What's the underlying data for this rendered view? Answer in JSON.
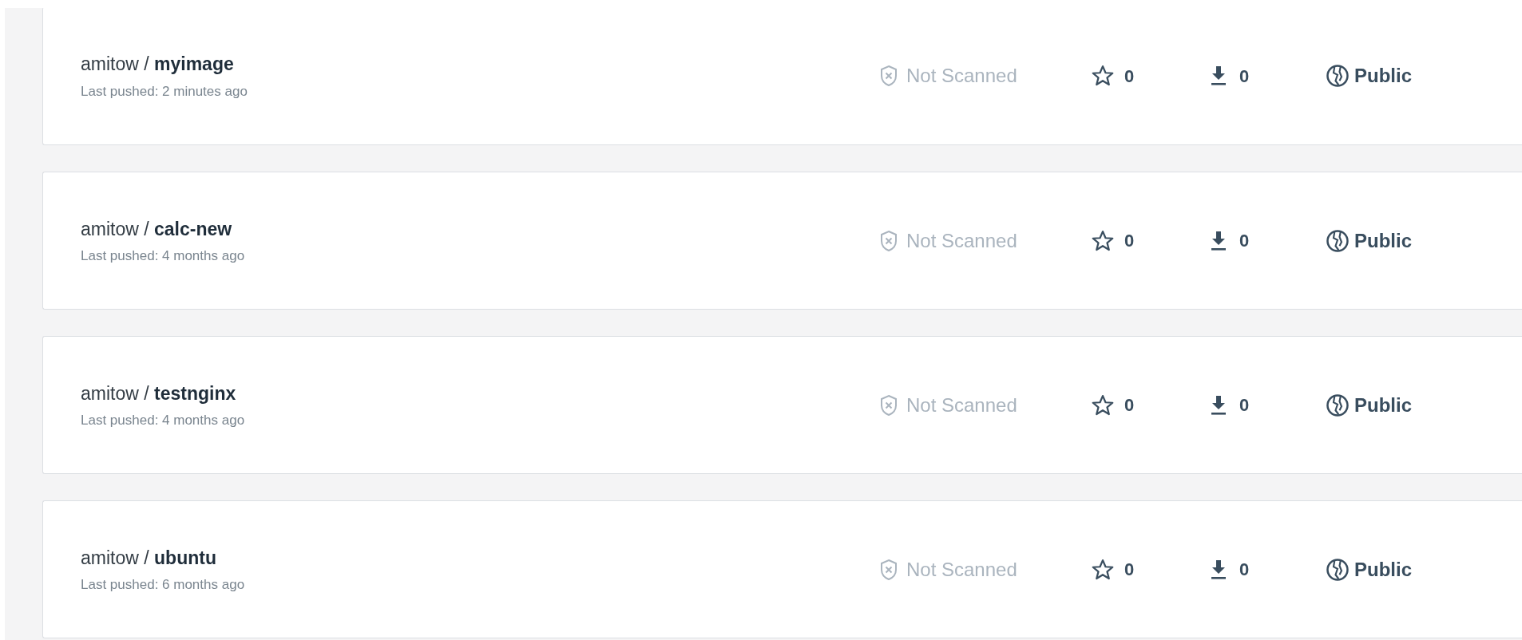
{
  "repositories": [
    {
      "title": "amitow / **myimage**",
      "last_pushed": "Last pushed: 2 minutes ago",
      "scan_status": "Not Scanned",
      "stars": "0",
      "pulls": "0",
      "visibility": "Public"
    },
    {
      "title": "amitow / **calc-new**",
      "last_pushed": "Last pushed: 4 months ago",
      "scan_status": "Not Scanned",
      "stars": "0",
      "pulls": "0",
      "visibility": "Public"
    },
    {
      "title": "amitow / **testnginx**",
      "last_pushed": "Last pushed: 4 months ago",
      "scan_status": "Not Scanned",
      "stars": "0",
      "pulls": "0",
      "visibility": "Public"
    },
    {
      "title": "amitow / **ubuntu**",
      "last_pushed": "Last pushed: 6 months ago",
      "scan_status": "Not Scanned",
      "stars": "0",
      "pulls": "0",
      "visibility": "Public"
    }
  ]
}
